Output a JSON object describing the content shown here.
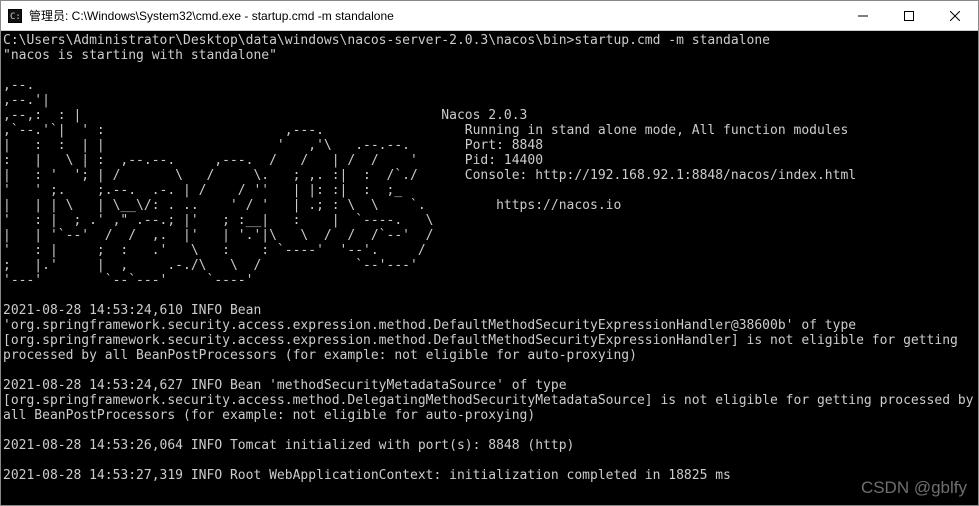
{
  "window": {
    "title": "管理员: C:\\Windows\\System32\\cmd.exe - startup.cmd  -m standalone"
  },
  "console": {
    "prompt_line": "C:\\Users\\Administrator\\Desktop\\data\\windows\\nacos-server-2.0.3\\nacos\\bin>startup.cmd -m standalone",
    "starting_line": "\"nacos is starting with standalone\"",
    "ascii_art": ",--.\n,--.'|\n,--,:  : |                                              Nacos 2.0.3\n,`--.'`|  ' :                       ,---.                  Running in stand alone mode, All function modules\n|   :  :  | |                      '   ,'\\   .--.--.       Port: 8848\n:   |   \\ | :  ,--.--.     ,---.  /   /   | /  /    '      Pid: 14400\n|   : '  '; | /       \\   /     \\.   ; ,. :|  :  /`./      Console: http://192.168.92.1:8848/nacos/index.html\n'   ' ;.    ;.--.  .-. | /    / ''   | |: :|  :  ;_\n|   | | \\   | \\__\\/: . ..    ' / '   | .; : \\  \\    `.         https://nacos.io\n'   : |  ; .' ,\" .--.; |'   ; :__|   :    |  `----.   \\\n|   | '`--'  /  /  ,.  |'   | '.'|\\   \\  /  /  /`--'  /\n'   : |     ;  :   .'   \\   :    : `----'  '--'.     /\n;   |.'     |  ,     .-./\\   \\  /            `--'---'\n'---'        `--`---'     `----'",
    "info": {
      "version": "Nacos 2.0.3",
      "mode": "Running in stand alone mode, All function modules",
      "port": "Port: 8848",
      "pid": "Pid: 14400",
      "console_url": "Console: http://192.168.92.1:8848/nacos/index.html",
      "site": "https://nacos.io"
    },
    "log_lines": [
      "2021-08-28 14:53:24,610 INFO Bean 'org.springframework.security.access.expression.method.DefaultMethodSecurityExpressionHandler@38600b' of type [org.springframework.security.access.expression.method.DefaultMethodSecurityExpressionHandler] is not eligible for getting processed by all BeanPostProcessors (for example: not eligible for auto-proxying)",
      "2021-08-28 14:53:24,627 INFO Bean 'methodSecurityMetadataSource' of type [org.springframework.security.access.method.DelegatingMethodSecurityMetadataSource] is not eligible for getting processed by all BeanPostProcessors (for example: not eligible for auto-proxying)",
      "2021-08-28 14:53:26,064 INFO Tomcat initialized with port(s): 8848 (http)",
      "2021-08-28 14:53:27,319 INFO Root WebApplicationContext: initialization completed in 18825 ms"
    ]
  },
  "watermark": "CSDN @gblfy"
}
